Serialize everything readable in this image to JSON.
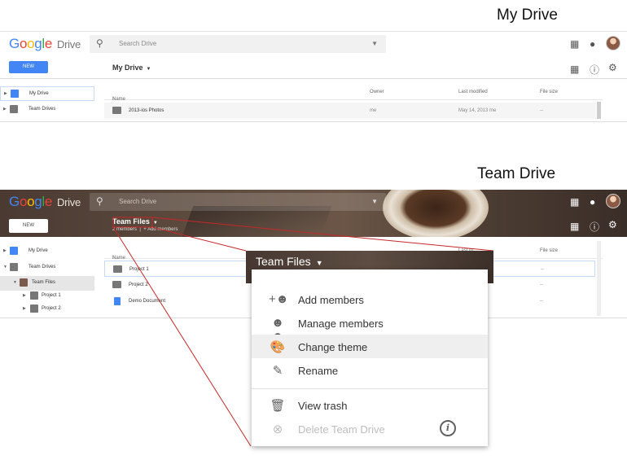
{
  "captions": {
    "my_drive": "My Drive",
    "team_drive": "Team Drive"
  },
  "logo": {
    "google": [
      "G",
      "o",
      "o",
      "g",
      "l",
      "e"
    ],
    "drive": "Drive"
  },
  "search": {
    "placeholder": "Search Drive"
  },
  "buttons": {
    "new": "NEW"
  },
  "icons": {
    "search": "search-icon",
    "apps": "apps-grid-icon",
    "notifications": "notifications-icon",
    "grid_view": "grid-view-icon",
    "info": "info-icon",
    "settings": "settings-gear-icon"
  },
  "colors": {
    "primary_blue": "#4285f4",
    "google_red": "#ea4335",
    "google_yellow": "#fbbc05",
    "google_green": "#34a853"
  },
  "panel1": {
    "breadcrumb": "My Drive",
    "sidebar": [
      {
        "label": "My Drive",
        "active": true
      },
      {
        "label": "Team Drives",
        "active": false
      }
    ],
    "columns": {
      "name": "Name",
      "owner": "Owner",
      "last_modified": "Last modified",
      "file_size": "File size"
    },
    "files": [
      {
        "name": "2013-ios Photos",
        "owner": "me",
        "modified": "May 14, 2013 me",
        "size": "--"
      }
    ]
  },
  "panel2": {
    "breadcrumb": "Team Files",
    "members": "2 members",
    "add_members_link": "+ Add members",
    "sidebar": [
      {
        "label": "My Drive"
      },
      {
        "label": "Team Drives"
      },
      {
        "label": "Team Files"
      },
      {
        "label": "Project 1"
      },
      {
        "label": "Project 2"
      }
    ],
    "columns": {
      "name": "Name",
      "last_modified": "Last m",
      "file_size": "File size"
    },
    "files": [
      {
        "name": "Project 1",
        "size": "--"
      },
      {
        "name": "Project 2",
        "size": "--"
      },
      {
        "name": "Demo Document",
        "size": "--"
      }
    ]
  },
  "popup": {
    "title": "Team Files",
    "items": [
      {
        "label": "Add members",
        "icon": "add-members-icon",
        "disabled": false
      },
      {
        "label": "Manage members",
        "icon": "manage-members-icon",
        "disabled": false
      },
      {
        "label": "Change theme",
        "icon": "palette-icon",
        "disabled": false,
        "hover": true
      },
      {
        "label": "Rename",
        "icon": "rename-icon",
        "disabled": false
      },
      {
        "label": "View trash",
        "icon": "trash-icon",
        "disabled": false
      },
      {
        "label": "Delete Team Drive",
        "icon": "delete-circle-icon",
        "disabled": true
      }
    ]
  }
}
